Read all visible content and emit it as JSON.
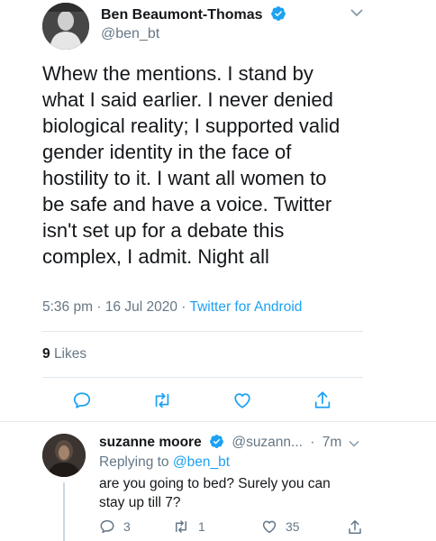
{
  "main_tweet": {
    "author_name": "Ben Beaumont-Thomas",
    "author_handle": "@ben_bt",
    "lines": [
      "Whew the mentions. I stand by",
      "what I said earlier. I never denied",
      "biological reality; I supported valid",
      "gender identity in the face of",
      "hostility to it. I want all women to",
      "be safe and have a voice. Twitter",
      "isn't set up for a debate this",
      "complex, I admit. Night all"
    ],
    "time": "5:36 pm",
    "date": "16 Jul 2020",
    "separator": "·",
    "source": "Twitter for Android",
    "likes_count": "9",
    "likes_label": "Likes"
  },
  "reply": {
    "author_name": "suzanne moore",
    "author_handle": "@suzann...",
    "separator": "·",
    "age": "7m",
    "replying_prefix": "Replying to",
    "replying_to": "@ben_bt",
    "text_lines": [
      "are you going to bed? Surely you can",
      "stay up till 7?"
    ],
    "reply_count": "3",
    "retweet_count": "1",
    "like_count": "35"
  },
  "icons": {
    "reply": "reply-icon",
    "retweet": "retweet-icon",
    "like": "heart-icon",
    "share": "share-icon",
    "verified": "verified-badge-icon",
    "more": "chevron-down-icon"
  },
  "colors": {
    "link": "#1da1f2",
    "secondary_text": "#657786",
    "divider": "#e1e8ed"
  }
}
